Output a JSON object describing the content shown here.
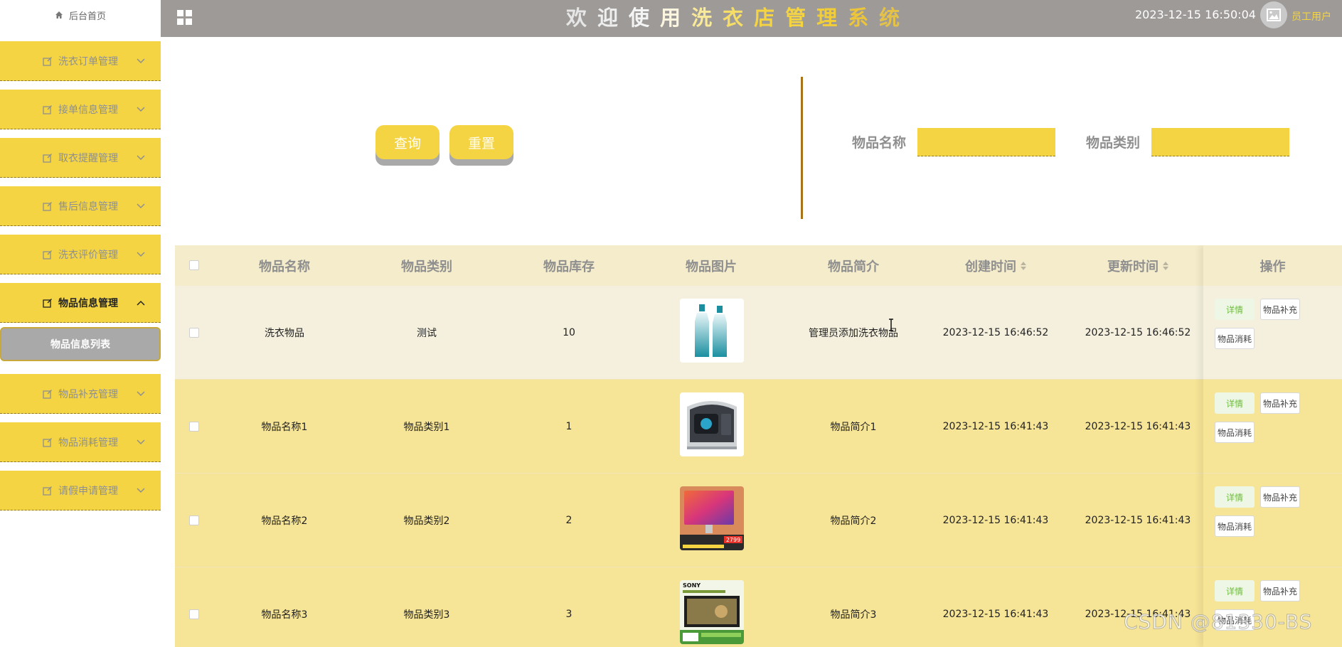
{
  "sidebar": {
    "home_label": "后台首页",
    "items": [
      {
        "label": "洗衣订单管理"
      },
      {
        "label": "接单信息管理"
      },
      {
        "label": "取衣提醒管理"
      },
      {
        "label": "售后信息管理"
      },
      {
        "label": "洗衣评价管理"
      },
      {
        "label": "物品信息管理"
      },
      {
        "label": "物品补充管理"
      },
      {
        "label": "物品消耗管理"
      },
      {
        "label": "请假申请管理"
      }
    ],
    "active_sub_label": "物品信息列表"
  },
  "header": {
    "title_chars": [
      "欢",
      "迎",
      "使",
      "用",
      "洗",
      "衣",
      "店",
      "管",
      "理",
      "系",
      "统"
    ],
    "datetime": "2023-12-15 16:50:04",
    "user_name": "员工用户"
  },
  "search": {
    "query_label": "查询",
    "reset_label": "重置",
    "name_label": "物品名称",
    "category_label": "物品类别",
    "name_value": "",
    "category_value": ""
  },
  "table": {
    "columns": [
      "物品名称",
      "物品类别",
      "物品库存",
      "物品图片",
      "物品简介",
      "创建时间",
      "更新时间",
      "操作"
    ],
    "rows": [
      {
        "name": "洗衣物品",
        "category": "测试",
        "stock": "10",
        "image": "bottles",
        "intro": "管理员添加洗衣物品",
        "created": "2023-12-15 16:46:52",
        "updated": "2023-12-15 16:46:52"
      },
      {
        "name": "物品名称1",
        "category": "物品类别1",
        "stock": "1",
        "image": "pc",
        "intro": "物品简介1",
        "created": "2023-12-15 16:41:43",
        "updated": "2023-12-15 16:41:43"
      },
      {
        "name": "物品名称2",
        "category": "物品类别2",
        "stock": "2",
        "image": "monitor",
        "intro": "物品简介2",
        "created": "2023-12-15 16:41:43",
        "updated": "2023-12-15 16:41:43"
      },
      {
        "name": "物品名称3",
        "category": "物品类别3",
        "stock": "3",
        "image": "tv",
        "intro": "物品简介3",
        "created": "2023-12-15 16:41:43",
        "updated": "2023-12-15 16:41:43"
      }
    ],
    "actions": {
      "detail": "详情",
      "add": "物品补充",
      "consume": "物品消耗"
    }
  },
  "thumbs": {
    "monitor_price": "2799",
    "tv_brand": "SONY"
  },
  "watermark": "CSDN @81330-BS",
  "colors": {
    "accent_yellow": "#f4d442",
    "header_gray": "#9d9a98",
    "detail_green": "#6dbd3c"
  }
}
